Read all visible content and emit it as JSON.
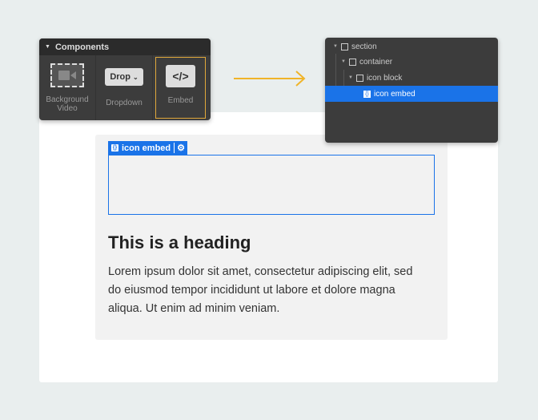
{
  "components_panel": {
    "title": "Components",
    "items": [
      {
        "label": "Background Video"
      },
      {
        "label": "Dropdown",
        "thumb": "Drop"
      },
      {
        "label": "Embed",
        "thumb": "</>"
      }
    ]
  },
  "navigator": {
    "items": [
      {
        "label": "section"
      },
      {
        "label": "container"
      },
      {
        "label": "icon block"
      },
      {
        "label": "icon embed"
      }
    ]
  },
  "canvas": {
    "tag_label": "icon embed",
    "heading": "This is a heading",
    "paragraph": "Lorem ipsum dolor sit amet, consectetur adipiscing elit, sed do eiusmod tempor incididunt ut labore et dolore magna aliqua. Ut enim ad minim veniam."
  },
  "colors": {
    "accent": "#1a73e8",
    "arrow": "#f0b429",
    "selected": "#e0a83a"
  }
}
